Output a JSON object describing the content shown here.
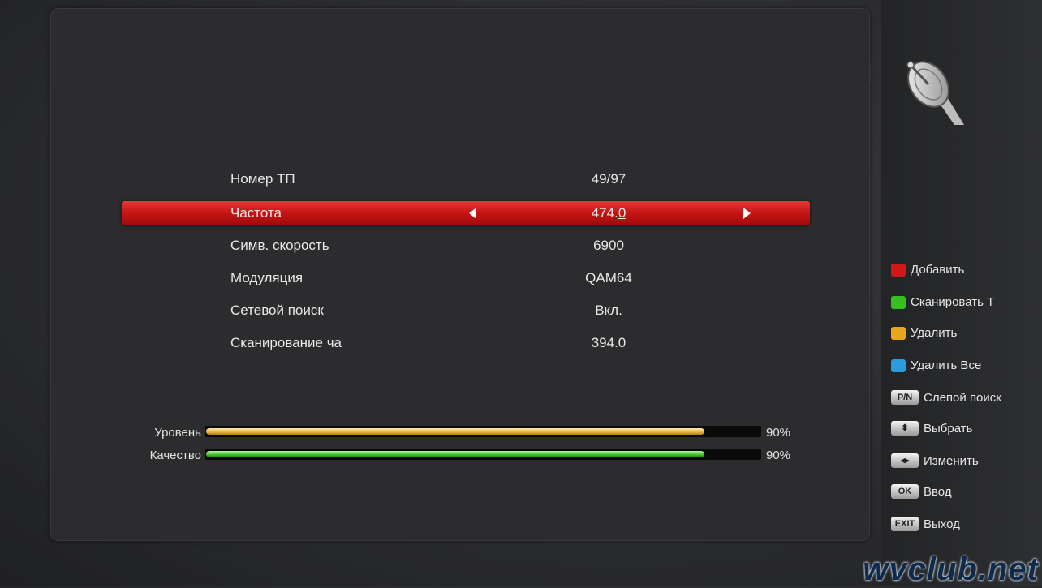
{
  "fields": [
    {
      "label": "Номер ТП",
      "value": "49/97"
    },
    {
      "label": "Частота",
      "value_main": "474.",
      "value_cursor": "0"
    },
    {
      "label": "Симв. скорость",
      "value": "6900"
    },
    {
      "label": "Модуляция",
      "value": "QAM64"
    },
    {
      "label": "Сетевой поиск",
      "value": "Вкл."
    },
    {
      "label": "Сканирование ча",
      "value": "394.0"
    }
  ],
  "meters": [
    {
      "label": "Уровень",
      "percent_text": "90%",
      "fill": 0.9,
      "color": "#e8b33c"
    },
    {
      "label": "Качество",
      "percent_text": "90%",
      "fill": 0.9,
      "color": "#3fbf2e"
    }
  ],
  "keys": [
    {
      "key": "red",
      "color": "#d01818",
      "label": "Добавить"
    },
    {
      "key": "green",
      "color": "#35c020",
      "label": "Сканировать Т"
    },
    {
      "key": "yellow",
      "color": "#e7a81c",
      "label": "Удалить"
    },
    {
      "key": "blue",
      "color": "#2a9bdc",
      "label": "Удалить Все"
    },
    {
      "key": "P/N",
      "button_text": "P/N",
      "label": "Слепой поиск"
    },
    {
      "key": "up-down",
      "button_text": "⬍",
      "label": "Выбрать"
    },
    {
      "key": "left-right",
      "button_text": "◂▸",
      "label": "Изменить"
    },
    {
      "key": "OK",
      "button_text": "OK",
      "label": "Ввод"
    },
    {
      "key": "EXIT",
      "button_text": "EXIT",
      "label": "Выход"
    }
  ],
  "icons": {
    "header": "satellite-dish-icon"
  },
  "watermark": "wvclub.net",
  "colors": {
    "selected_row": "#c81616",
    "background": "#2c2c2e"
  }
}
